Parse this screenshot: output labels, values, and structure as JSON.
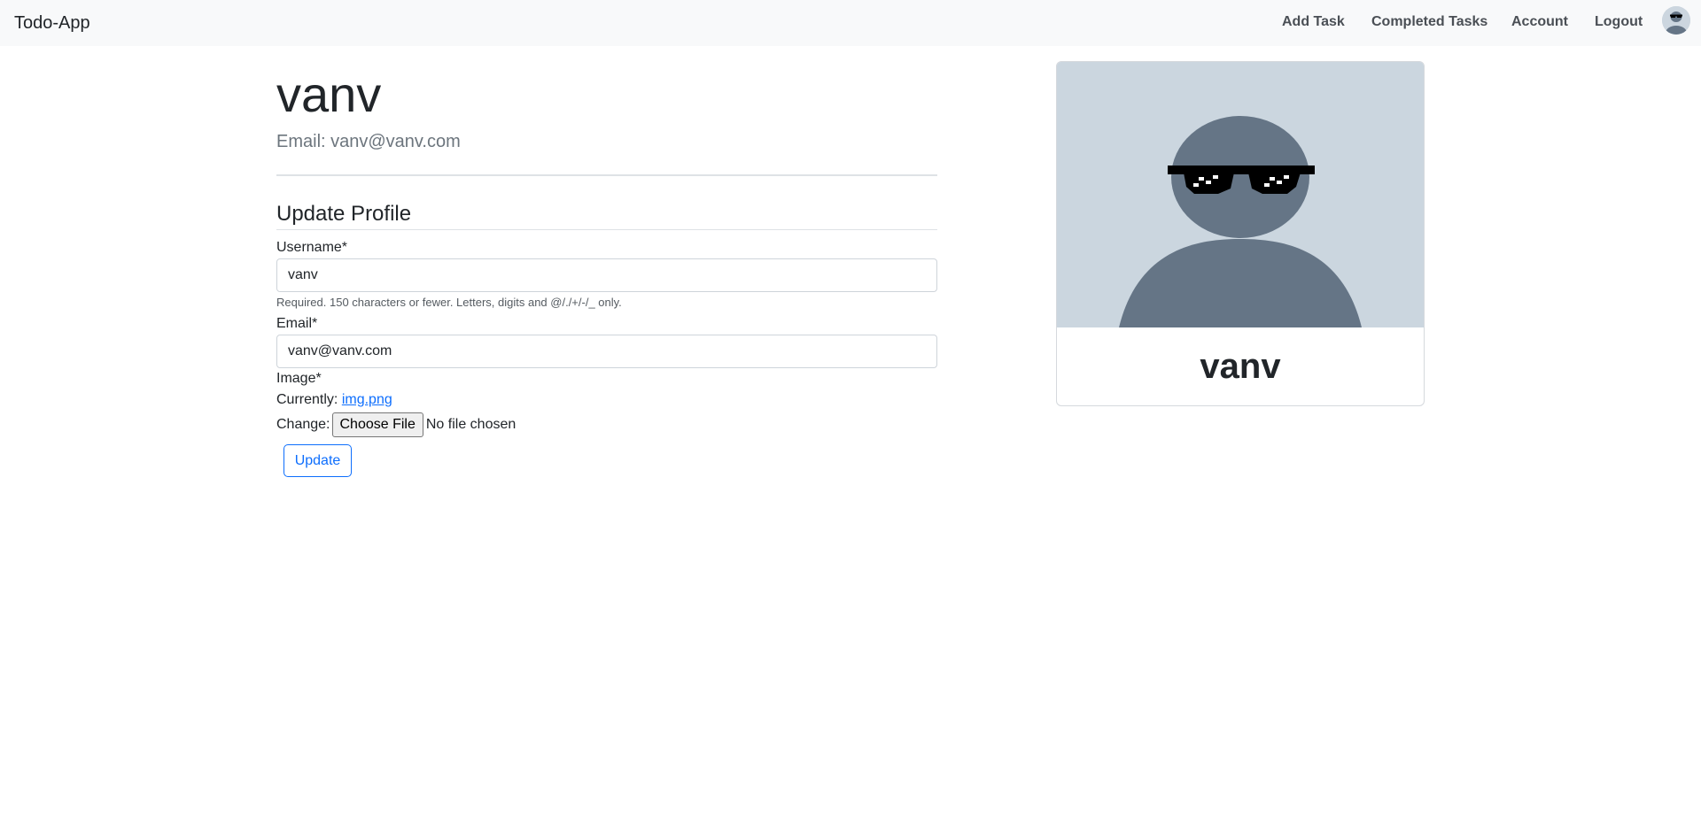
{
  "navbar": {
    "brand": "Todo-App",
    "links": [
      "Add Task",
      "Completed Tasks",
      "Account",
      "Logout"
    ],
    "avatar_icon": "user-avatar-sunglasses"
  },
  "profile": {
    "username": "vanv",
    "email_line": "Email: vanv@vanv.com"
  },
  "form": {
    "title": "Update Profile",
    "username_label": "Username*",
    "username_value": "vanv",
    "username_help": "Required. 150 characters or fewer. Letters, digits and @/./+/-/_ only.",
    "email_label": "Email*",
    "email_value": "vanv@vanv.com",
    "image_label": "Image*",
    "currently_label": "Currently:",
    "current_file": "img.png",
    "change_label": "Change:",
    "choose_file_button": "Choose File",
    "no_file_text": "No file chosen",
    "submit_label": "Update"
  },
  "card": {
    "name": "vanv",
    "image_icon": "avatar-sunglasses"
  },
  "colors": {
    "navbar_bg": "#f8f9fa",
    "primary": "#0d6efd",
    "avatar_bg": "#cbd6df",
    "avatar_figure": "#657586"
  }
}
